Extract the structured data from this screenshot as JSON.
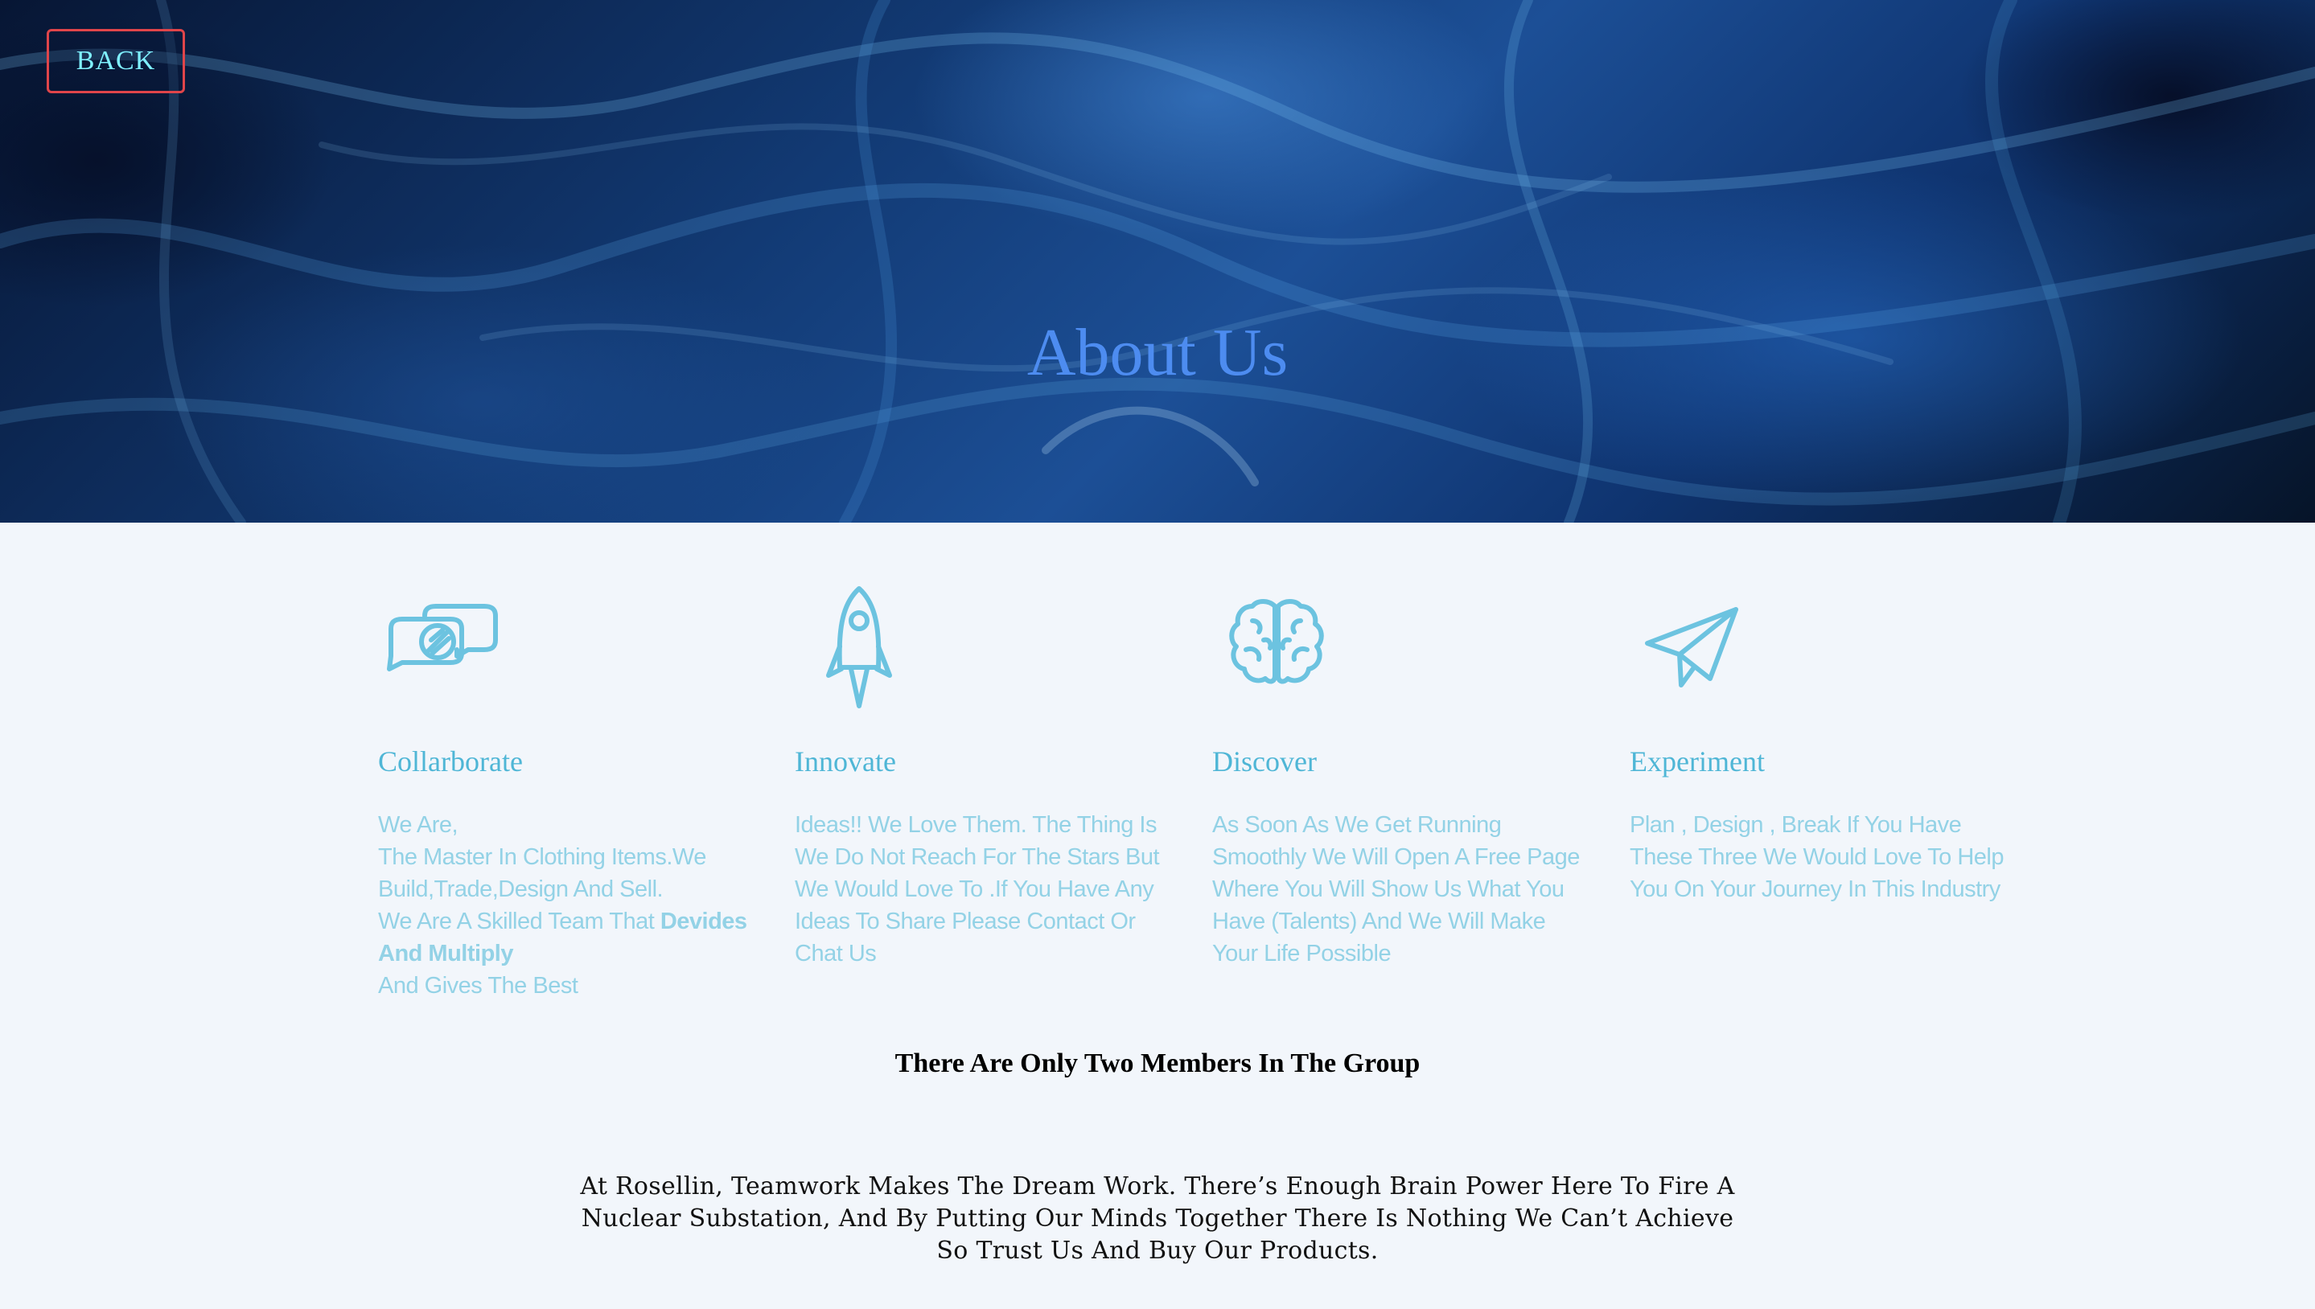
{
  "header": {
    "back_label": "BACK",
    "title": "About Us"
  },
  "features": [
    {
      "icon": "chat-bubbles-icon",
      "title": "Collarborate",
      "lines": [
        "We Are,",
        "The Master In Clothing Items.We Build,Trade,Design And Sell.",
        "We Are A Skilled Team That "
      ],
      "bold": "Devides And Multiply",
      "after": "And Gives The Best"
    },
    {
      "icon": "rocket-icon",
      "title": "Innovate",
      "text": "Ideas!! We Love Them. The Thing Is We Do Not Reach For The Stars But We Would Love To .If You Have Any Ideas To Share Please Contact Or Chat Us"
    },
    {
      "icon": "brain-icon",
      "title": "Discover",
      "text": "As Soon As We Get Running Smoothly We Will Open A Free Page Where You Will Show Us What You Have (Talents) And We Will Make Your Life Possible"
    },
    {
      "icon": "paper-plane-icon",
      "title": "Experiment",
      "text": "Plan , Design , Break If You Have These Three We Would Love To Help You On Your Journey In This Industry"
    }
  ],
  "members_heading": "There Are Only Two Members In The Group",
  "teamwork_text": "At Rosellin, Teamwork Makes The Dream Work. There’s Enough Brain Power Here To Fire A Nuclear Substation, And By Putting Our Minds Together There Is Nothing We Can’t Achieve So Trust Us And Buy Our Products.",
  "colors": {
    "accent_title": "#4d8cf0",
    "feature_title": "#4fb6d6",
    "feature_text": "#93d2e6",
    "icon_stroke": "#6cc3e0",
    "back_border": "#e0454a",
    "back_text": "#7ff0ff"
  }
}
